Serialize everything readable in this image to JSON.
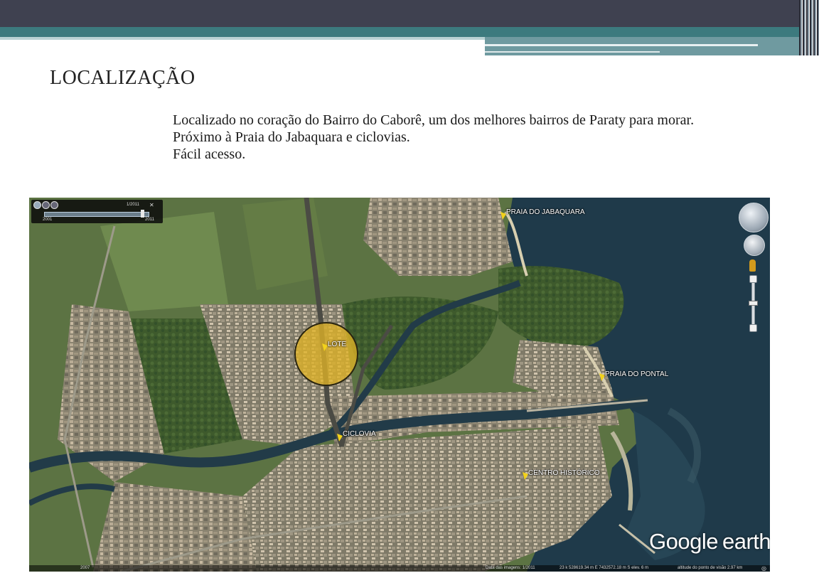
{
  "slide": {
    "title": "LOCALIZAÇÃO",
    "paragraphs": [
      "Localizado no coração do Bairro do Caborê, um dos melhores bairros de Paraty para morar.",
      "Próximo à Praia do Jabaquara e ciclovias.",
      "Fácil acesso."
    ]
  },
  "map": {
    "slider": {
      "date": "1/2011",
      "start_year": "2001",
      "end_year": "2011"
    },
    "labels": {
      "praia_jabaquara": "PRAIA DO JABAQUARA",
      "lote": "LOTE",
      "praia_pontal": "PRAIA DO PONTAL",
      "ciclovia": "CICLOVIA",
      "centro_historico": "CENTRO HISTÓRICO"
    },
    "brand": {
      "google": "Google",
      "earth": "earth"
    },
    "status": {
      "year": "2007",
      "imagery_date": "Data das imagens: 1/2011",
      "coords": "23 k 528619.34 m E 7432572.18 m S  elev.   6 m",
      "eye_alt": "altitude do ponto de visão   2.97 km"
    },
    "icons": [
      "globe-icon",
      "zoom-in-icon",
      "zoom-out-icon",
      "compass-icon",
      "look-icon",
      "pegman-icon",
      "zoom-slider-icon",
      "placemark-icon"
    ],
    "colors": {
      "highlight_circle": "#dfb226",
      "placemark": "#f2d21b",
      "water": "#1f3a4a"
    }
  }
}
